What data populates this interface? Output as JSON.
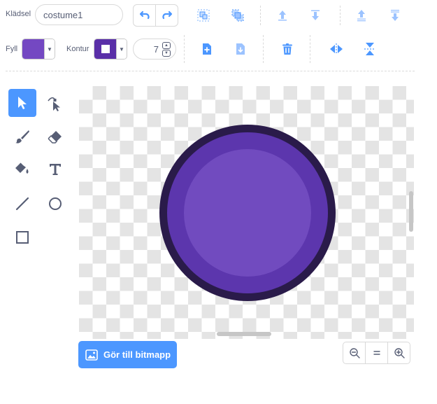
{
  "costume": {
    "label": "Klädsel",
    "name_value": "costume1",
    "name_placeholder": ""
  },
  "toolbar": {
    "undo_icon": "undo-icon",
    "redo_icon": "redo-icon",
    "group_icon": "group-icon",
    "ungroup_icon": "ungroup-icon",
    "forward_icon": "forward-icon",
    "backward_icon": "backward-icon",
    "front_icon": "front-icon",
    "back_icon": "back-icon"
  },
  "style": {
    "fill_label": "Fyll",
    "fill_color": "#7448c2",
    "outline_label": "Kontur",
    "outline_color": "#5a2fa8",
    "outline_width": "7"
  },
  "actions": {
    "copy_icon": "copy-icon",
    "paste_icon": "paste-icon",
    "delete_icon": "trash-icon",
    "flip_horizontal_icon": "flip-horizontal-icon",
    "flip_vertical_icon": "flip-vertical-icon"
  },
  "tools": [
    "select",
    "reshape",
    "brush",
    "eraser",
    "fill",
    "text",
    "line",
    "circle",
    "rectangle"
  ],
  "canvas": {
    "shape": "circle",
    "outer_ring_color": "#2a1b4a",
    "middle_ring_color": "#5c36ad",
    "inner_fill_color": "#714bbf"
  },
  "footer": {
    "convert_label": "Gör till bitmapp",
    "zoom_out_icon": "zoom-out-icon",
    "zoom_reset_icon": "zoom-reset-icon",
    "zoom_in_icon": "zoom-in-icon"
  }
}
